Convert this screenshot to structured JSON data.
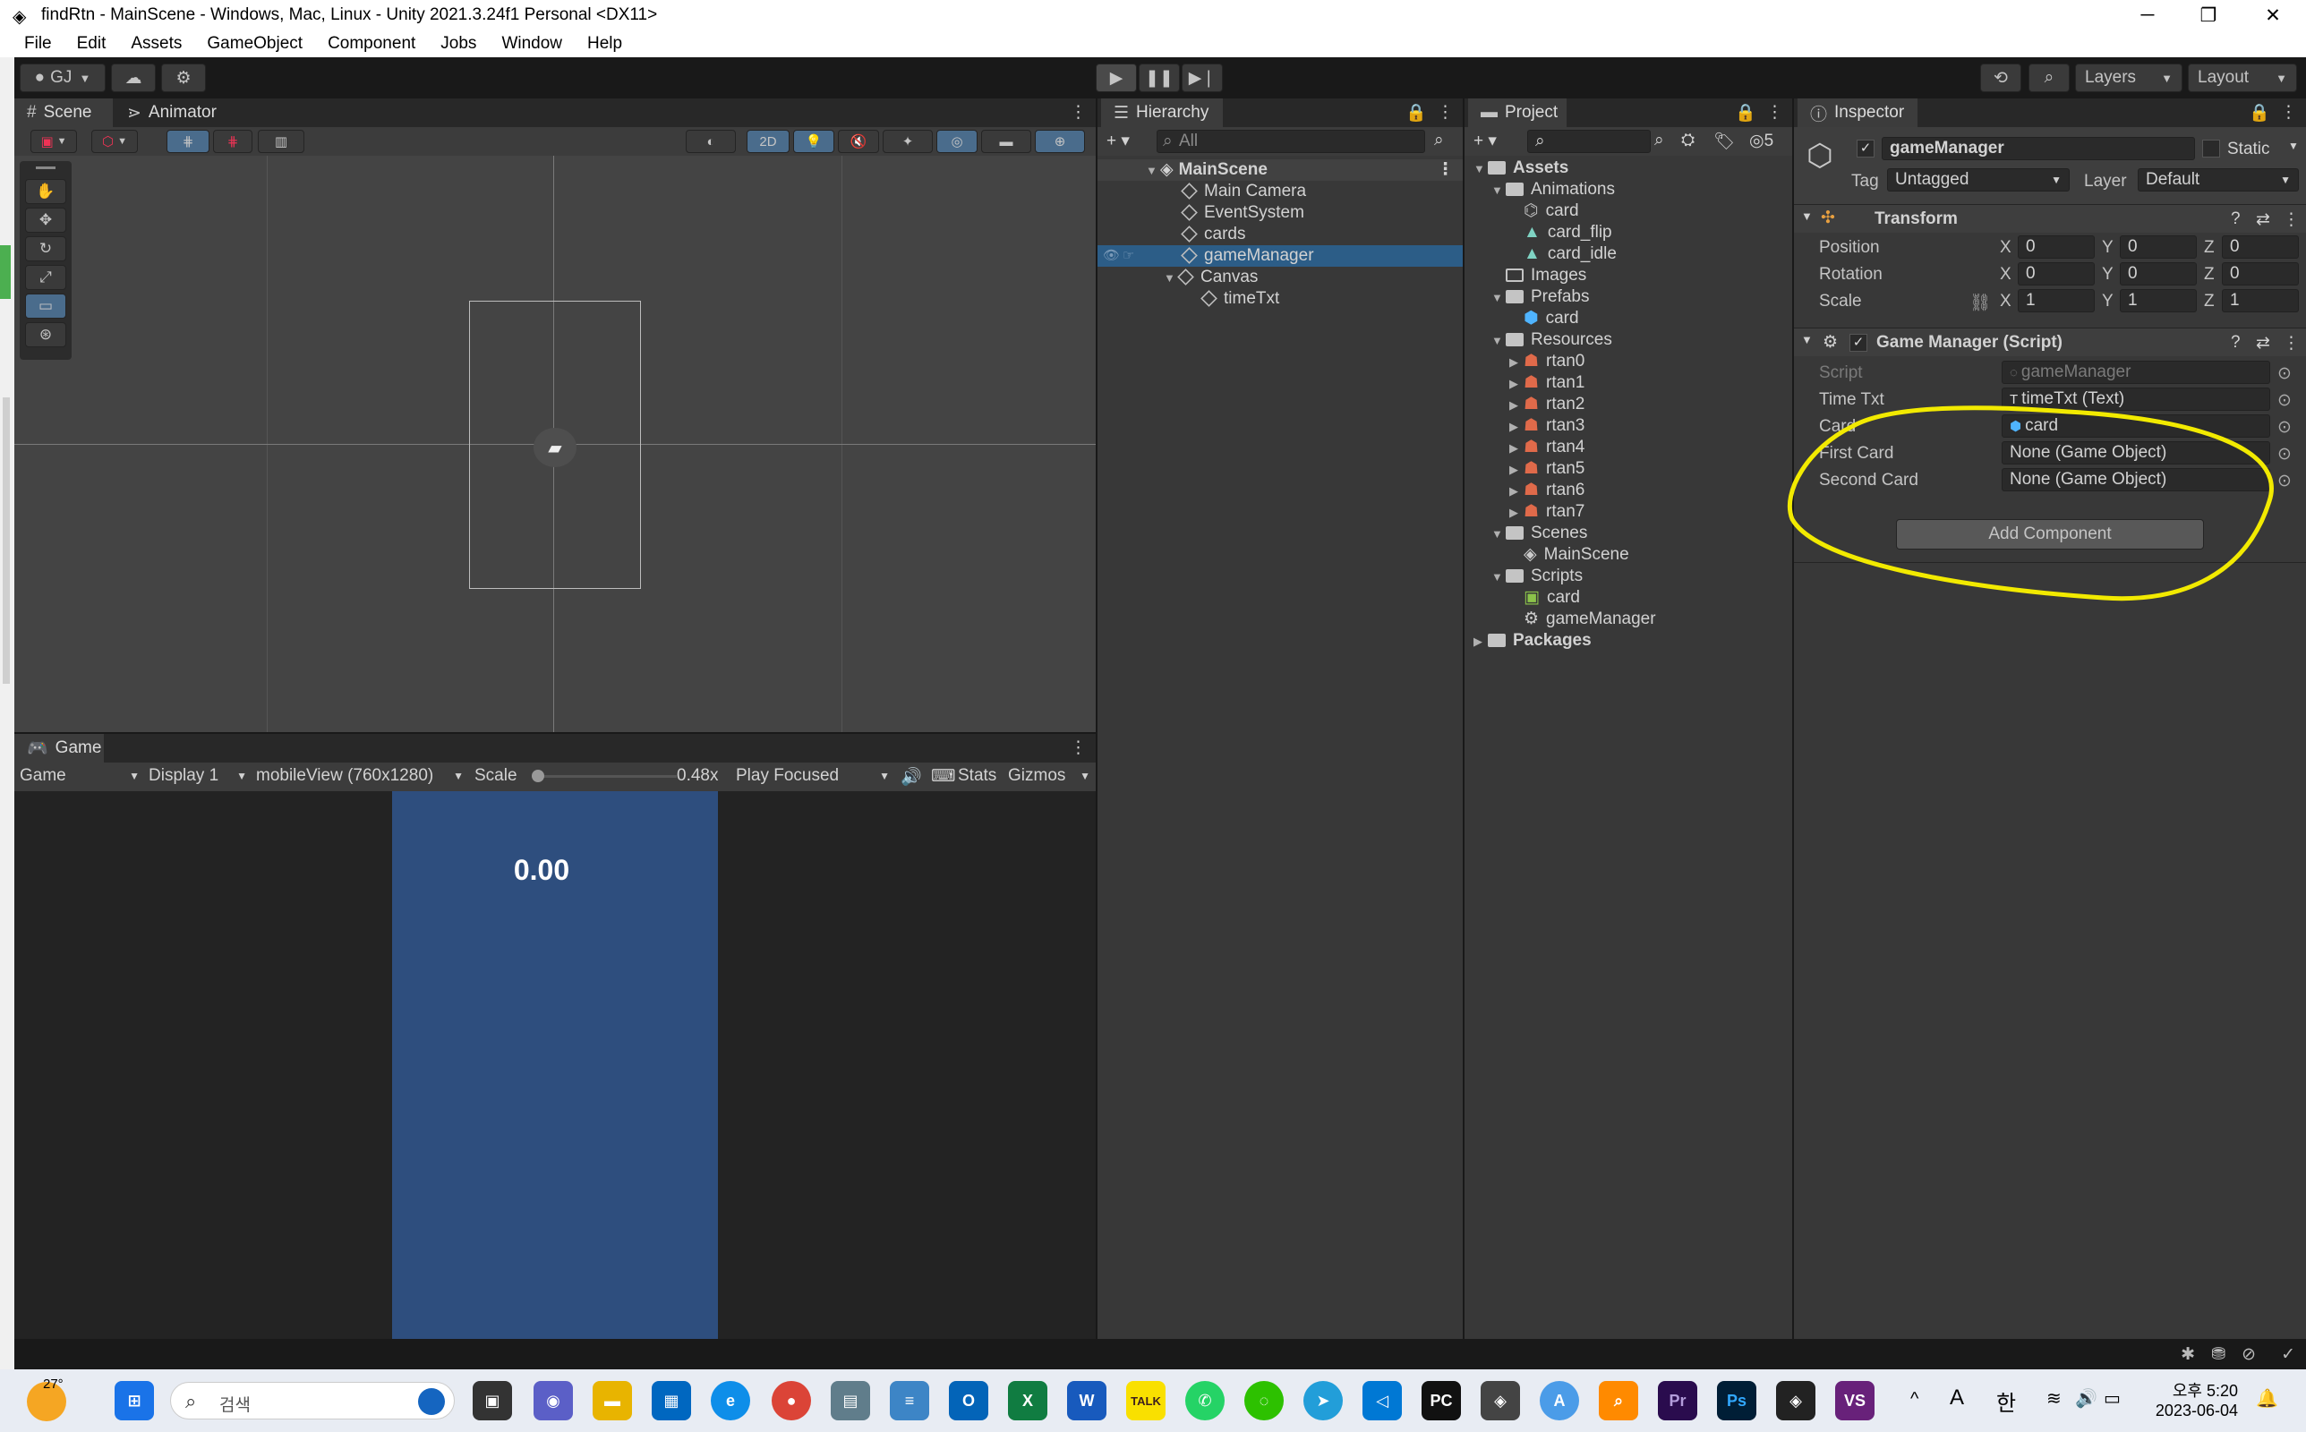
{
  "window": {
    "title": "findRtn - MainScene - Windows, Mac, Linux - Unity 2021.3.24f1 Personal <DX11>",
    "controls": [
      "─",
      "❐",
      "✕"
    ]
  },
  "menu": [
    "File",
    "Edit",
    "Assets",
    "GameObject",
    "Component",
    "Jobs",
    "Window",
    "Help"
  ],
  "toolbar": {
    "account": "GJ",
    "layers": "Layers",
    "layout": "Layout"
  },
  "scene": {
    "tabs": [
      "Scene",
      "Animator"
    ],
    "mode_2d": "2D"
  },
  "game": {
    "tab": "Game",
    "view_mode": "Game",
    "display": "Display 1",
    "resolution": "mobileView (760x1280)",
    "scale_label": "Scale",
    "scale_value": "0.48x",
    "play_mode": "Play Focused",
    "stats": "Stats",
    "gizmos": "Gizmos",
    "timer_text": "0.00",
    "canvas_color": "#2e4e7e"
  },
  "hierarchy": {
    "tab": "Hierarchy",
    "search_placeholder": "All",
    "scene": "MainScene",
    "items": [
      "Main Camera",
      "EventSystem",
      "cards",
      "gameManager",
      "Canvas",
      "timeTxt"
    ]
  },
  "project": {
    "tab": "Project",
    "hidden_count": "5",
    "tree": [
      {
        "label": "Assets",
        "depth": 0,
        "type": "folder-open"
      },
      {
        "label": "Animations",
        "depth": 1,
        "type": "folder-open"
      },
      {
        "label": "card",
        "depth": 2,
        "type": "animator"
      },
      {
        "label": "card_flip",
        "depth": 2,
        "type": "anim"
      },
      {
        "label": "card_idle",
        "depth": 2,
        "type": "anim"
      },
      {
        "label": "Images",
        "depth": 1,
        "type": "folder-empty"
      },
      {
        "label": "Prefabs",
        "depth": 1,
        "type": "folder-open"
      },
      {
        "label": "card",
        "depth": 2,
        "type": "prefab"
      },
      {
        "label": "Resources",
        "depth": 1,
        "type": "folder-open"
      },
      {
        "label": "rtan0",
        "depth": 2,
        "type": "sprite"
      },
      {
        "label": "rtan1",
        "depth": 2,
        "type": "sprite"
      },
      {
        "label": "rtan2",
        "depth": 2,
        "type": "sprite"
      },
      {
        "label": "rtan3",
        "depth": 2,
        "type": "sprite"
      },
      {
        "label": "rtan4",
        "depth": 2,
        "type": "sprite"
      },
      {
        "label": "rtan5",
        "depth": 2,
        "type": "sprite"
      },
      {
        "label": "rtan6",
        "depth": 2,
        "type": "sprite"
      },
      {
        "label": "rtan7",
        "depth": 2,
        "type": "sprite"
      },
      {
        "label": "Scenes",
        "depth": 1,
        "type": "folder-open"
      },
      {
        "label": "MainScene",
        "depth": 2,
        "type": "scene"
      },
      {
        "label": "Scripts",
        "depth": 1,
        "type": "folder-open"
      },
      {
        "label": "card",
        "depth": 2,
        "type": "script"
      },
      {
        "label": "gameManager",
        "depth": 2,
        "type": "script-gear"
      },
      {
        "label": "Packages",
        "depth": 0,
        "type": "folder-closed"
      }
    ]
  },
  "inspector": {
    "tab": "Inspector",
    "object_name": "gameManager",
    "static_label": "Static",
    "tag_label": "Tag",
    "tag_value": "Untagged",
    "layer_label": "Layer",
    "layer_value": "Default",
    "transform": {
      "title": "Transform",
      "rows": [
        {
          "label": "Position",
          "x": "0",
          "y": "0",
          "z": "0"
        },
        {
          "label": "Rotation",
          "x": "0",
          "y": "0",
          "z": "0"
        },
        {
          "label": "Scale",
          "x": "1",
          "y": "1",
          "z": "1"
        }
      ]
    },
    "script_component": {
      "title": "Game Manager (Script)",
      "fields": [
        {
          "label": "Script",
          "value": "gameManager"
        },
        {
          "label": "Time Txt",
          "value": "timeTxt (Text)"
        },
        {
          "label": "Card",
          "value": "card"
        },
        {
          "label": "First Card",
          "value": "None (Game Object)"
        },
        {
          "label": "Second Card",
          "value": "None (Game Object)"
        }
      ]
    },
    "add_component": "Add Component",
    "annotation_color": "#f2ea00"
  },
  "taskbar": {
    "weather": "27°",
    "search_placeholder": "검색",
    "time": "오후 5:20",
    "date": "2023-06-04",
    "ime_a": "A",
    "ime_han": "한"
  }
}
